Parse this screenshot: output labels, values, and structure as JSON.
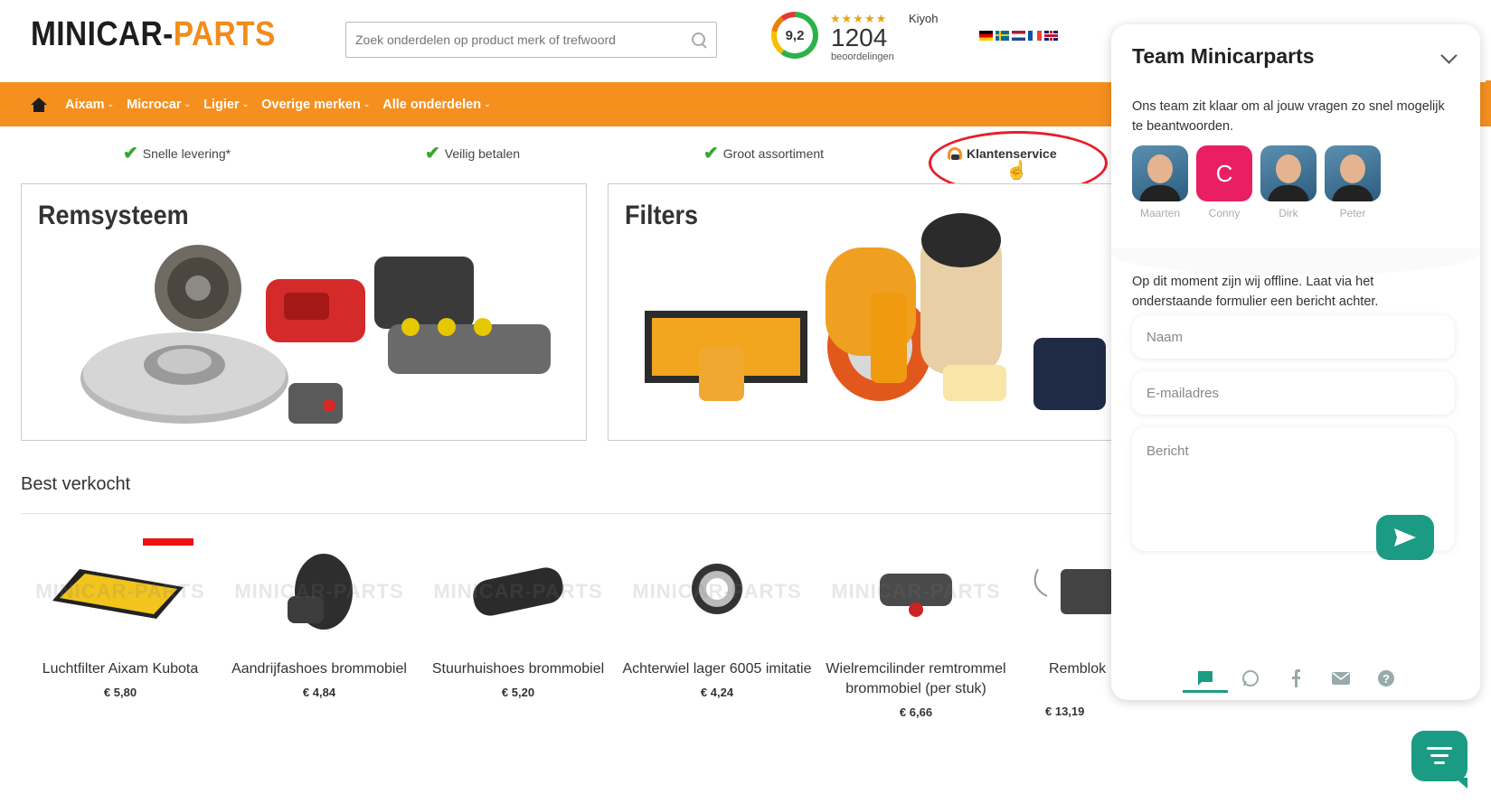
{
  "header": {
    "logo_part1": "MINICAR-",
    "logo_part2": "PARTS",
    "search_placeholder": "Zoek onderdelen op product merk of trefwoord",
    "rating": {
      "score": "9,2",
      "stars": "★★★★★",
      "brand": "Kiyoh",
      "count": "1204",
      "count_label": "beoordelingen"
    },
    "languages": [
      "de",
      "se",
      "nl",
      "fr",
      "gb"
    ]
  },
  "nav": {
    "items": [
      {
        "label": "Aixam"
      },
      {
        "label": "Microcar"
      },
      {
        "label": "Ligier"
      },
      {
        "label": "Overige merken"
      },
      {
        "label": "Alle onderdelen"
      }
    ]
  },
  "usps": {
    "fast_delivery": "Snelle levering*",
    "safe_payment": "Veilig betalen",
    "assortment": "Groot assortiment",
    "customer_service": "Klantenservice"
  },
  "categories": {
    "brakes": "Remsysteem",
    "filters": "Filters"
  },
  "best_sold": {
    "title": "Best verkocht",
    "watermark": "MINICAR-PARTS",
    "products": [
      {
        "name": "Luchtfilter Aixam Kubota",
        "price": "€ 5,80"
      },
      {
        "name": "Aandrijfashoes brommobiel",
        "price": "€ 4,84"
      },
      {
        "name": "Stuurhuishoes brommobiel",
        "price": "€ 5,20"
      },
      {
        "name": "Achterwiel lager 6005 imitatie",
        "price": "€ 4,24"
      },
      {
        "name": "Wielremcilinder remtrommel brommobiel (per stuk)",
        "price": "€ 6,66"
      },
      {
        "name": "Remblok",
        "price": "€ 13,19"
      }
    ]
  },
  "chat": {
    "title": "Team Minicarparts",
    "intro": "Ons team zit klaar om al jouw vragen zo snel mogelijk te beantwoorden.",
    "agents": [
      {
        "name": "Maarten"
      },
      {
        "name": "Conny",
        "initial": "C"
      },
      {
        "name": "Dirk"
      },
      {
        "name": "Peter"
      }
    ],
    "offline_message": "Op dit moment zijn wij offline. Laat via het onderstaande formulier een bericht achter.",
    "name_placeholder": "Naam",
    "email_placeholder": "E-mailadres",
    "message_placeholder": "Bericht",
    "accent_color": "#1b9b84",
    "tabs": [
      "chat-icon",
      "whatsapp-icon",
      "facebook-icon",
      "mail-icon",
      "help-icon"
    ]
  },
  "colors": {
    "brand_orange": "#f5901f",
    "check_green": "#36a831",
    "highlight_red": "#e5202a"
  }
}
